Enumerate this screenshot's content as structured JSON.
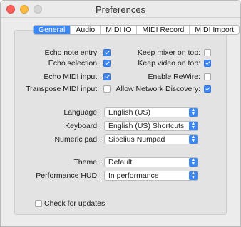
{
  "window": {
    "title": "Preferences"
  },
  "tabs": [
    {
      "label": "General",
      "active": true
    },
    {
      "label": "Audio",
      "active": false
    },
    {
      "label": "MIDI IO",
      "active": false
    },
    {
      "label": "MIDI Record",
      "active": false
    },
    {
      "label": "MIDI Import",
      "active": false
    }
  ],
  "checkboxes": {
    "echo_note_entry": {
      "label": "Echo note entry:",
      "checked": true
    },
    "echo_selection": {
      "label": "Echo selection:",
      "checked": true
    },
    "echo_midi_input": {
      "label": "Echo MIDI input:",
      "checked": true
    },
    "transpose_midi_input": {
      "label": "Transpose MIDI input:",
      "checked": false
    },
    "keep_mixer_on_top": {
      "label": "Keep mixer on top:",
      "checked": false
    },
    "keep_video_on_top": {
      "label": "Keep video on top:",
      "checked": true
    },
    "enable_rewire": {
      "label": "Enable ReWire:",
      "checked": false
    },
    "allow_network_discovery": {
      "label": "Allow Network Discovery:",
      "checked": true
    },
    "check_for_updates": {
      "label": "Check for updates",
      "checked": false
    }
  },
  "selects": {
    "language": {
      "label": "Language:",
      "value": "English (US)"
    },
    "keyboard": {
      "label": "Keyboard:",
      "value": "English (US) Shortcuts"
    },
    "numeric_pad": {
      "label": "Numeric pad:",
      "value": "Sibelius Numpad"
    },
    "theme": {
      "label": "Theme:",
      "value": "Default"
    },
    "performance_hud": {
      "label": "Performance HUD:",
      "value": "In performance"
    }
  },
  "colors": {
    "accent": "#3d87f5",
    "close": "#fc605b",
    "minimize": "#fdbc40",
    "zoom_disabled": "#d5d5d5"
  }
}
